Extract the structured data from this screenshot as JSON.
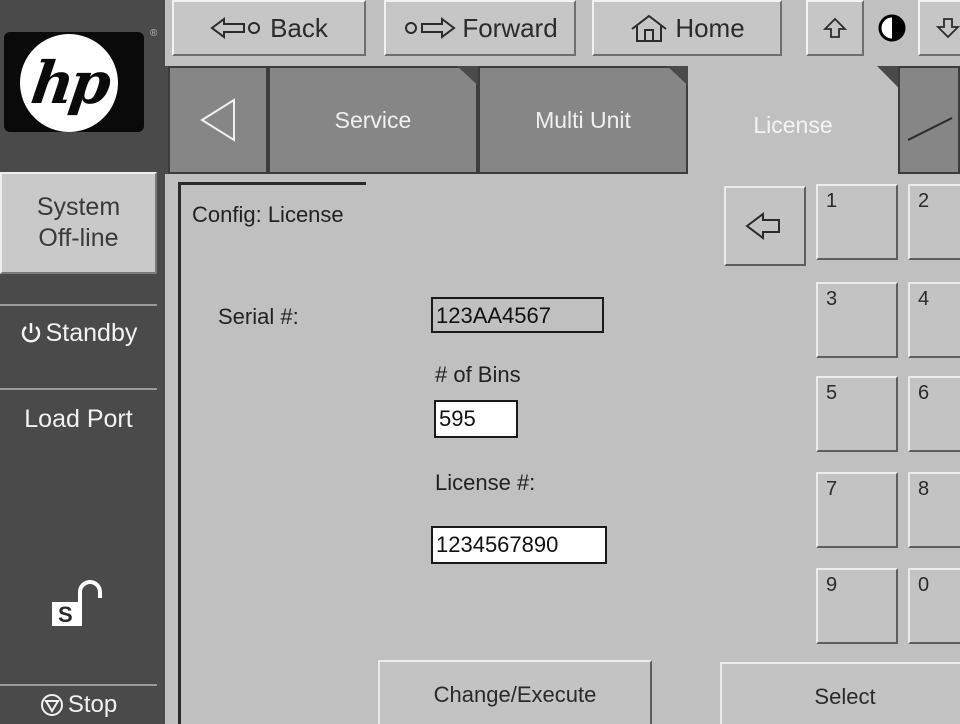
{
  "nav": {
    "back_label": "Back",
    "forward_label": "Forward",
    "home_label": "Home"
  },
  "logo": {
    "text": "hp"
  },
  "sidebar": {
    "offline_label_line1": "System",
    "offline_label_line2": "Off-line",
    "standby_label": "Standby",
    "loadport_label": "Load Port",
    "lock_letter": "S",
    "stop_label": "Stop"
  },
  "tabs": [
    {
      "label": "Service"
    },
    {
      "label": "Multi Unit"
    },
    {
      "label": "License"
    }
  ],
  "form": {
    "title": "Config: License",
    "serial_label": "Serial #:",
    "serial_value": "123AA4567",
    "bins_label": "# of Bins",
    "bins_value": "595",
    "license_label": "License #:",
    "license_value": "1234567890"
  },
  "keypad": [
    "1",
    "2",
    "3",
    "4",
    "5",
    "6",
    "7",
    "8",
    "9",
    "0"
  ],
  "actions": {
    "change_label": "Change/Execute",
    "select_label": "Select"
  },
  "colors": {
    "background": "#c0c0c0",
    "sidebar": "#4a4a4a",
    "tab_inactive": "#868686"
  }
}
